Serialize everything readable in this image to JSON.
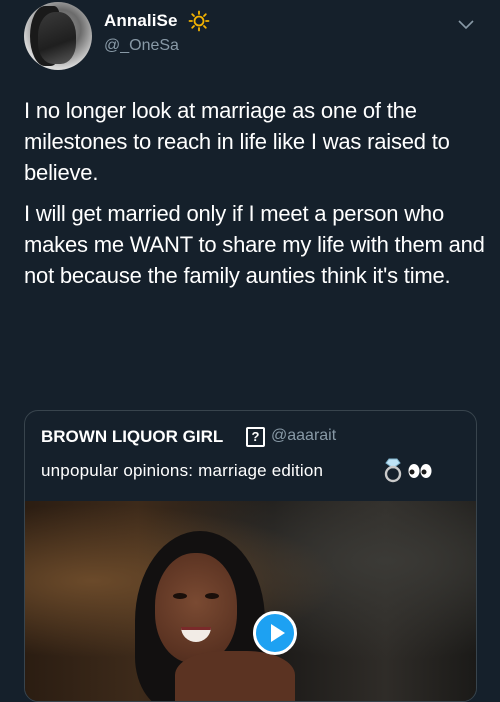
{
  "user": {
    "display_name": "AnnaliSe",
    "handle": "@_OneSa"
  },
  "tweet": {
    "paragraphs": [
      "I no longer look at marriage as one of the milestones to reach in life like I was raised to believe.",
      "I will get married only if I meet a person who makes me WANT to share my life with them and not because the family aunties think it's time."
    ]
  },
  "quoted_tweet": {
    "display_name": "BROWN LIQUOR GIRL",
    "unknown_glyph": "?",
    "handle": "@aaarait",
    "text": "unpopular opinions: marriage edition"
  },
  "colors": {
    "background": "#15202b",
    "secondary_text": "#8899a6",
    "border": "#38444d",
    "accent": "#1da1f2"
  },
  "icons": {
    "name_emoji": "sun-icon",
    "dropdown": "chevron-down-icon",
    "quote_emoji_1": "ring-icon",
    "quote_emoji_2": "eyes-icon",
    "media": "play-icon"
  }
}
